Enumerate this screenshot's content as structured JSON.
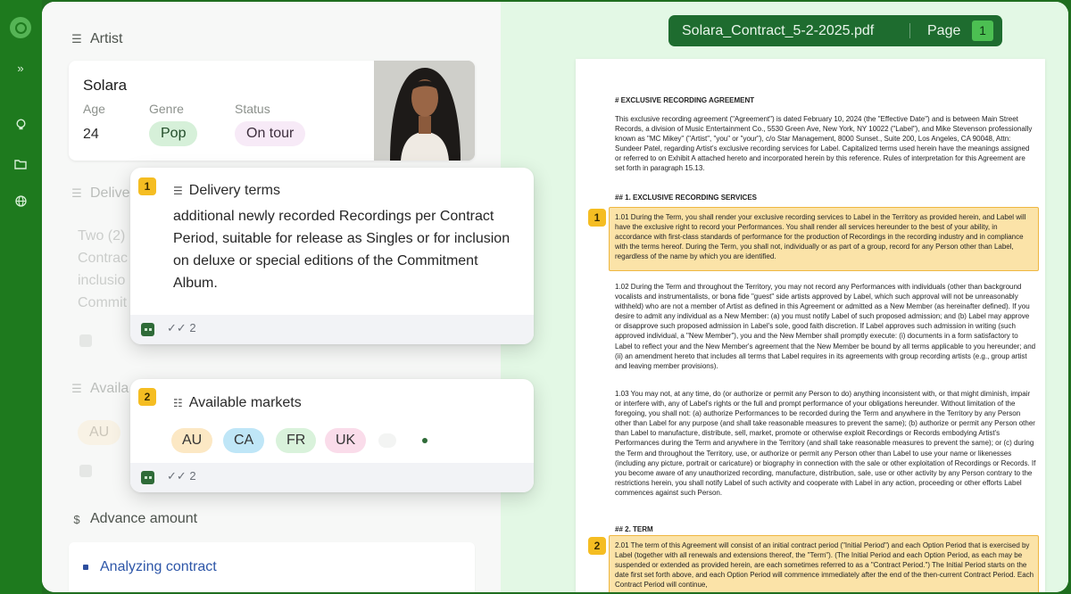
{
  "rail": {
    "icons": [
      "logo-icon",
      "expand-icon",
      "lightbulb-icon",
      "folder-icon",
      "globe-icon"
    ]
  },
  "artist": {
    "section_label": "Artist",
    "name": "Solara",
    "age_label": "Age",
    "age": "24",
    "genre_label": "Genre",
    "genre": "Pop",
    "status_label": "Status",
    "status": "On tour"
  },
  "delivery_bg": {
    "section_label": "Delive",
    "lines": [
      "Two (2)",
      "Contrac",
      "inclusio",
      "Commit"
    ]
  },
  "markets_bg": {
    "section_label": "Availa",
    "first": "AU"
  },
  "popup1": {
    "badge": "1",
    "title": "Delivery terms",
    "body": "additional newly recorded Recordings per Contract Period, suitable for release as Singles or for inclusion on deluxe or special editions of the Commitment Album.",
    "checks": "2"
  },
  "popup2": {
    "badge": "2",
    "title": "Available markets",
    "markets": [
      "AU",
      "CA",
      "FR",
      "UK"
    ],
    "checks": "2"
  },
  "advance": {
    "section_label": "Advance amount",
    "status": "Analyzing contract"
  },
  "document": {
    "filename": "Solara_Contract_5-2-2025.pdf",
    "page_label": "Page",
    "page_number": "1",
    "heading": "# EXCLUSIVE RECORDING AGREEMENT",
    "intro": "This exclusive recording agreement (\"Agreement\") is dated February 10, 2024 (the \"Effective Date\") and is between Main Street Records, a division of Music Entertainment Co., 5530 Green Ave, New York, NY 10022 (\"Label\"), and Mike Stevenson professionally known as \"MC Mikey\" (\"Artist\", \"you\" or \"your\"), c/o Star Management, 8000 Sunset., Suite 200, Los Angeles, CA 90048, Attn: Sundeer Patel, regarding Artist's exclusive recording services for Label. Capitalized terms used herein have the meanings assigned or referred to on Exhibit A attached hereto and incorporated herein by this reference. Rules of interpretation for this Agreement are set forth in paragraph 15.13.",
    "section1": "## 1. EXCLUSIVE RECORDING SERVICES",
    "p101": "1.01 During the Term, you shall render your exclusive recording services to Label in the Territory as provided herein, and Label will have the exclusive right to record your Performances. You shall render all services hereunder to the best of your ability, in accordance with first-class standards of performance for the production of Recordings in the recording industry and in compliance with the terms hereof. During the Term, you shall not, individually or as part of a group, record for any Person other than Label, regardless of the name by which you are identified.",
    "p102": "1.02 During the Term and throughout the Territory, you may not record any Performances with individuals (other than background vocalists and instrumentalists, or bona fide \"guest\" side artists approved by Label, which such approval will not be unreasonably withheld) who are not a member of Artist as defined in this Agreement or admitted as a New Member (as hereinafter defined). If you desire to admit any individual as a New Member: (a) you must notify Label of such proposed admission; and (b) Label may approve or disapprove such proposed admission in Label's sole, good faith discretion. If Label approves such admission in writing (such approved individual, a \"New Member\"), you and the New Member shall promptly execute: (i) documents in a form satisfactory to Label to reflect your and the New Member's agreement that the New Member be bound by all terms applicable to you hereunder; and (ii) an amendment hereto that includes all terms that Label requires in its agreements with group recording artists (e.g., group artist and leaving member provisions).",
    "p103": "1.03 You may not, at any time, do (or authorize or permit any Person to do) anything inconsistent with, or that might diminish, impair or interfere with, any of Label's rights or the full and prompt performance of your obligations hereunder. Without limitation of the foregoing, you shall not: (a) authorize Performances to be recorded during the Term and anywhere in the Territory by any Person other than Label for any purpose (and shall take reasonable measures to prevent the same); (b) authorize or permit any Person other than Label to manufacture, distribute, sell, market, promote or otherwise exploit Recordings or Records embodying Artist's Performances during the Term and anywhere in the Territory (and shall take reasonable measures to prevent the same); or (c) during the Term and throughout the Territory, use, or authorize or permit any Person other than Label to use your name or likenesses (including any picture, portrait or caricature) or biography in connection with the sale or other exploitation of Recordings or Records. If you become aware of any unauthorized recording, manufacture, distribution, sale, use or other activity by any Person contrary to the restrictions herein, you shall notify Label of such activity and cooperate with Label in any action, proceeding or other efforts Label commences against such Person.",
    "section2": "## 2. TERM",
    "p201": "2.01 The term of this Agreement will consist of an initial contract period (\"Initial Period\") and each Option Period that is exercised by Label (together with all renewals and extensions thereof, the \"Term\"). (The Initial Period and each Option Period, as each may be suspended or extended as provided herein, are each sometimes referred to as a \"Contract Period.\") The Initial Period starts on the date first set forth above, and each Option Period will commence immediately after the end of the then-current Contract Period. Each Contract Period will continue,",
    "badge1": "1",
    "badge2": "2"
  },
  "colors": {
    "rail": "#1e7a1e",
    "doc_bar": "#1e6c2f",
    "highlight": "#fbe3a8",
    "badge": "#f5bd22",
    "genre_pill": "#d6f0d9",
    "status_pill": "#f7eaf7",
    "au": "#fce8c4",
    "ca": "#bfe6f7",
    "fr": "#d9f2db",
    "uk": "#fadcea"
  }
}
